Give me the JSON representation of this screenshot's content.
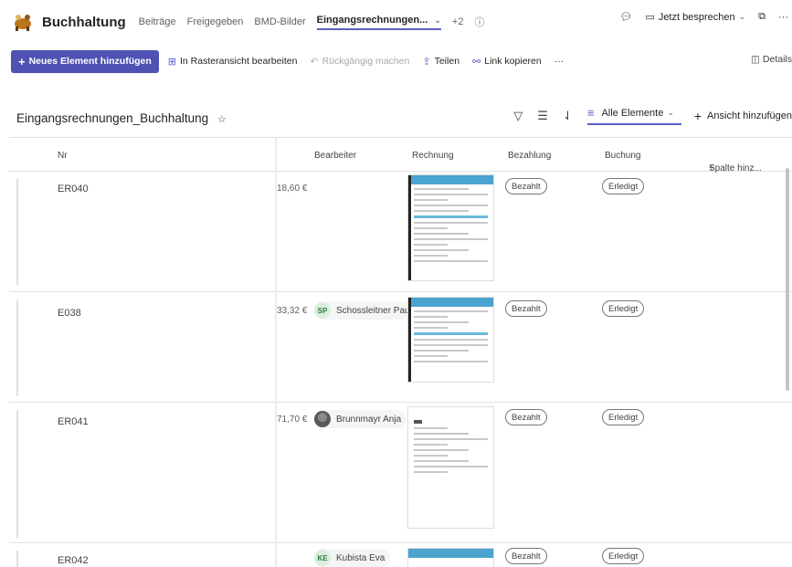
{
  "app": {
    "title": "Buchhaltung",
    "tabs": [
      {
        "label": "Beiträge"
      },
      {
        "label": "Freigegeben"
      },
      {
        "label": "BMD-Bilder"
      },
      {
        "label": "Eingangsrechnungen..."
      },
      {
        "label": "+2"
      }
    ],
    "meet_label": "Jetzt besprechen"
  },
  "commands": {
    "new_item": "Neues Element hinzufügen",
    "grid_edit": "In Rasteransicht bearbeiten",
    "undo": "Rückgängig machen",
    "share": "Teilen",
    "copy_link": "Link kopieren",
    "more": "···",
    "details": "Details"
  },
  "view": {
    "list_title": "Eingangsrechnungen_Buchhaltung",
    "current_view": "Alle Elemente",
    "add_view": "Ansicht hinzufügen"
  },
  "columns": {
    "nr": "Nr",
    "bearbeiter": "Bearbeiter",
    "rechnung": "Rechnung",
    "bezahlung": "Bezahlung",
    "buchung": "Buchung",
    "add_column": "Spalte hinz..."
  },
  "rows": [
    {
      "nr": "ER040",
      "amount": "18,60 €",
      "bearbeiter": "",
      "bezahlung": "Bezahlt",
      "buchung": "Erledigt"
    },
    {
      "nr": "E038",
      "amount": "33,32 €",
      "bearbeiter": "Schossleitner Paul",
      "initials": "SP",
      "bezahlung": "Bezahlt",
      "buchung": "Erledigt"
    },
    {
      "nr": "ER041",
      "amount": "71,70 €",
      "bearbeiter": "Brunnmayr Anja",
      "bezahlung": "Bezahlt",
      "buchung": "Erledigt"
    },
    {
      "nr": "ER042",
      "amount": "",
      "bearbeiter": "Kubista Eva",
      "initials": "KE",
      "bezahlung": "Bezahlt",
      "buchung": "Erledigt"
    }
  ],
  "colors": {
    "accent": "#4f52b2",
    "underline": "#5b5fc7",
    "doc_header": "#4aa4cf"
  },
  "icons": [
    "team-logo-icon",
    "chevron-down-icon",
    "info-icon",
    "chat-icon",
    "video-icon",
    "share-screen-icon",
    "grid-icon",
    "pencil-icon",
    "undo-icon",
    "share-icon",
    "link-icon",
    "filter-icon",
    "group-icon",
    "sort-icon",
    "list-view-icon",
    "star-icon",
    "plus-icon"
  ]
}
